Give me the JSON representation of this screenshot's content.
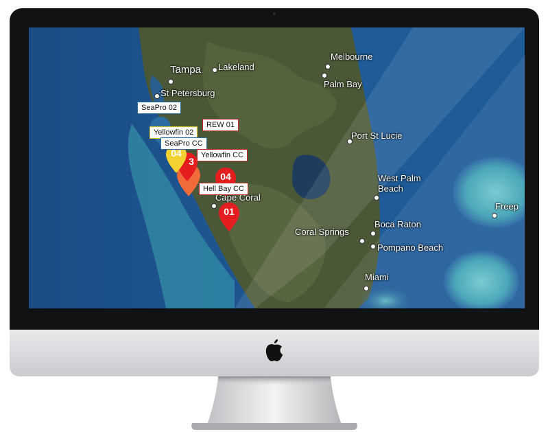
{
  "map": {
    "cities": [
      {
        "name": "Tampa",
        "size": "big"
      },
      {
        "name": "Lakeland",
        "size": "normal"
      },
      {
        "name": "St Petersburg",
        "size": "normal"
      },
      {
        "name": "Melbourne",
        "size": "normal"
      },
      {
        "name": "Palm Bay",
        "size": "normal"
      },
      {
        "name": "Port St Lucie",
        "size": "normal"
      },
      {
        "name": "West Palm Beach",
        "size": "normal"
      },
      {
        "name": "Cape Coral",
        "size": "normal"
      },
      {
        "name": "Boca Raton",
        "size": "normal"
      },
      {
        "name": "Coral Springs",
        "size": "normal"
      },
      {
        "name": "Pompano Beach",
        "size": "normal"
      },
      {
        "name": "Miami",
        "size": "normal"
      },
      {
        "name": "Freep",
        "size": "normal"
      }
    ],
    "boat_tags": [
      {
        "label": "SeaPro 02",
        "color": "#2b6ca3"
      },
      {
        "label": "Yellowfin 02",
        "color": "#e0c229"
      },
      {
        "label": "SeaPro CC",
        "color": "#2b6ca3"
      },
      {
        "label": "REW 01",
        "color": "#c62828"
      },
      {
        "label": "Yellowfin CC",
        "color": "#c62828"
      },
      {
        "label": "Hell Bay CC",
        "color": "#c62828"
      }
    ],
    "pins": [
      {
        "label": "04",
        "color": "#f2d230"
      },
      {
        "label": "3",
        "color": "#e41e1e"
      },
      {
        "label": "04",
        "color": "#e41e1e"
      },
      {
        "label": "01",
        "color": "#e41e1e"
      }
    ]
  },
  "colors": {
    "ocean": "#1d4f86",
    "land": "#4b5a3a",
    "bezel": "#111214",
    "pin_red": "#e41e1e",
    "pin_yellow": "#f2d230",
    "pin_blue": "#2b6ca3"
  }
}
